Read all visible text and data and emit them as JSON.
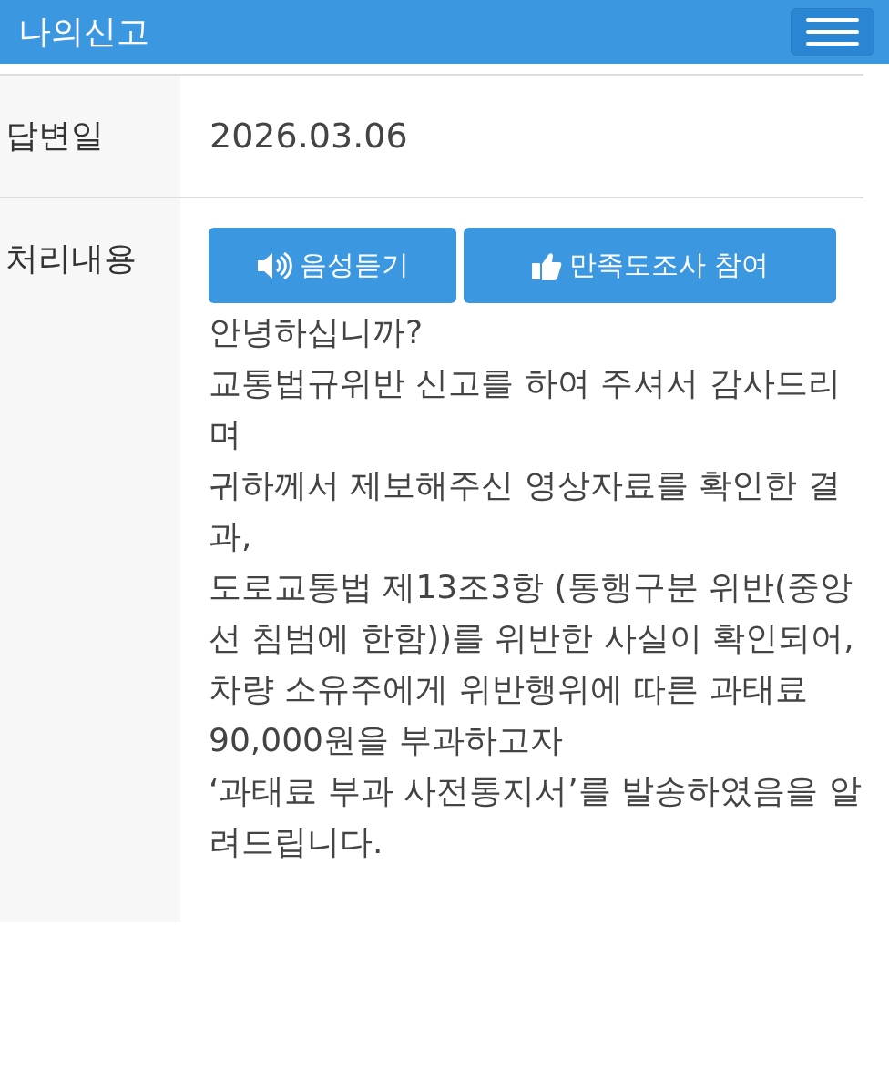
{
  "header": {
    "title": "나의신고"
  },
  "rows": [
    {
      "label": "답변일",
      "kind": "text",
      "value": "2026.03.06"
    },
    {
      "label": "처리내용",
      "kind": "message",
      "buttons": [
        {
          "label": "음성듣기",
          "kind": "speaker"
        },
        {
          "label": "만족도조사 참여",
          "kind": "thumb"
        }
      ],
      "lines": [
        "안녕하십니까?",
        "교통법규위반 신고를 하여 주셔서 감사드리며",
        "귀하께서 제보해주신 영상자료를 확인한 결과,",
        "도로교통법 제13조3항 (통행구분 위반(중앙선 침범에 한함))를 위반한 사실이 확인되어,",
        "차량 소유주에게 위반행위에 따른 과태료 90,000원을 부과하고자",
        "‘과태료 부과 사전통지서’를 발송하였음을 알려드립니다."
      ]
    }
  ]
}
